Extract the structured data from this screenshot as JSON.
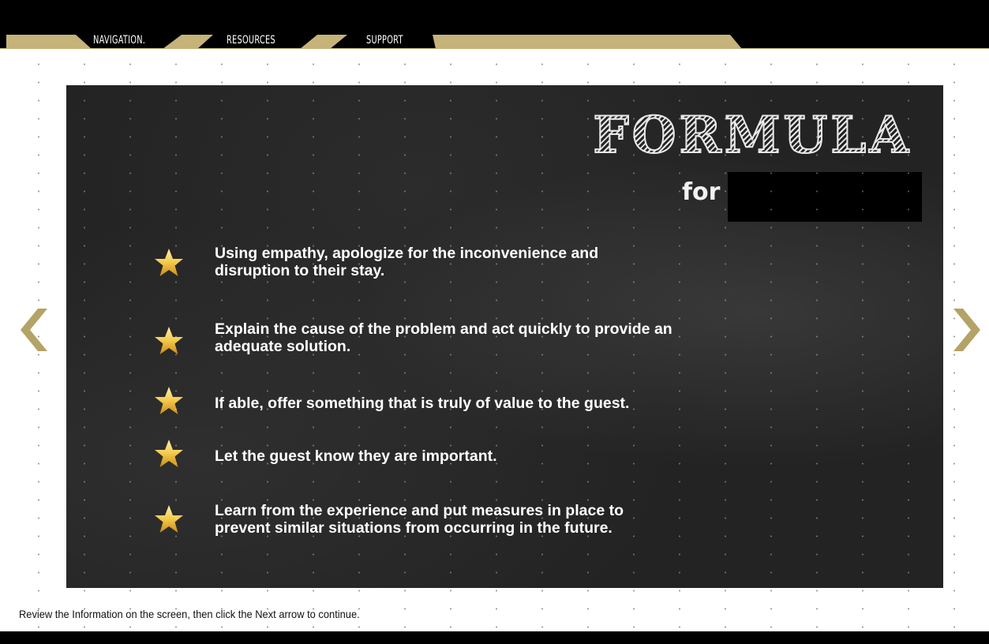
{
  "tabs": [
    {
      "label": "NAVIGATION."
    },
    {
      "label": "RESOURCES"
    },
    {
      "label": "SUPPORT"
    }
  ],
  "slide": {
    "title": "FORMULA",
    "subtitle_prefix": "for",
    "bullets": [
      {
        "text": "Using empathy, apologize for the inconvenience and\ndisruption to their stay."
      },
      {
        "text": "Explain the cause of the problem and act quickly to provide an\nadequate solution."
      },
      {
        "text": "If able, offer something that is truly of value to the guest."
      },
      {
        "text": "Let the guest know they are important."
      },
      {
        "text": "Learn from the experience and put measures in place to\nprevent similar situations from occurring in the future."
      }
    ]
  },
  "icons": {
    "bullet": "star-icon",
    "prev": "chevron-left-icon",
    "next": "chevron-right-icon"
  },
  "colors": {
    "accent_gold": "#c5b37a",
    "star_gold": "#f3c94a",
    "board": "#232323"
  },
  "footer": {
    "instructions": "Review the Information on the screen, then click the Next arrow to continue."
  }
}
